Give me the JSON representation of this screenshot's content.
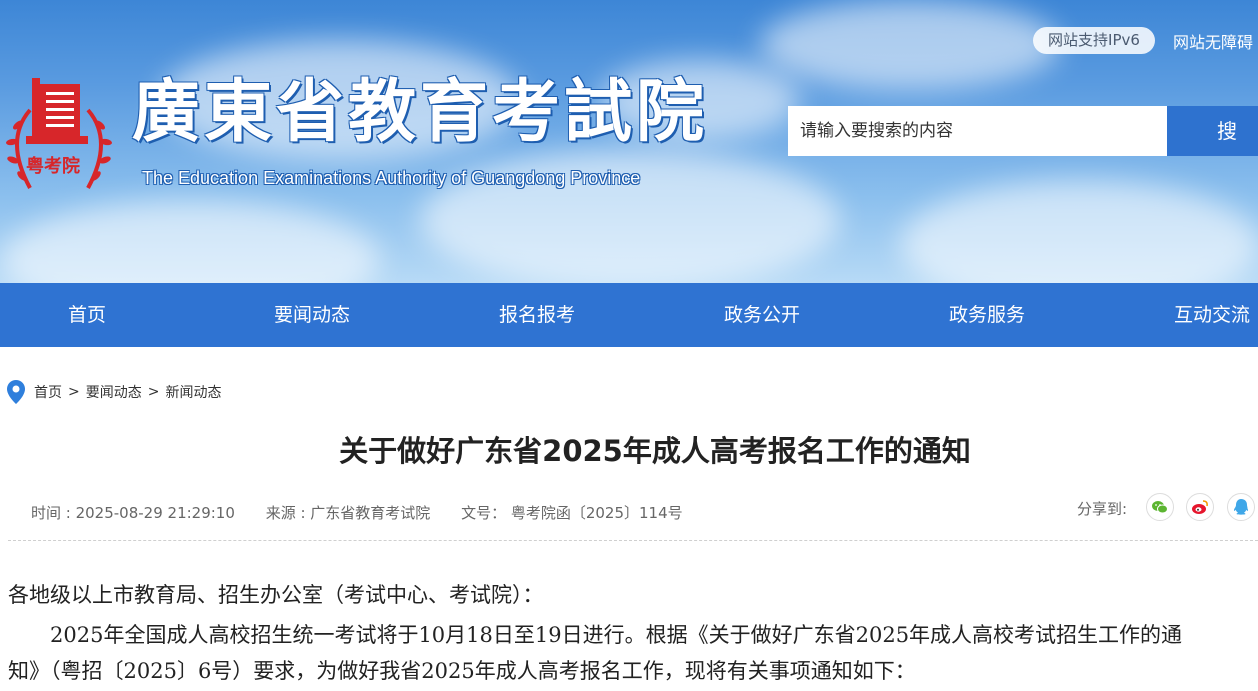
{
  "header": {
    "site_title": "廣東省教育考試院",
    "site_subtitle": "The Education Examinations Authority of Guangdong Province",
    "logo_text": "粤考院",
    "ipv6": "网站支持IPv6",
    "accessibility": "网站无障碍",
    "search_placeholder": "请输入要搜索的内容",
    "search_button": "搜"
  },
  "nav": {
    "items": [
      "首页",
      "要闻动态",
      "报名报考",
      "政务公开",
      "政务服务",
      "互动交流"
    ]
  },
  "breadcrumb": {
    "items": [
      "首页",
      "要闻动态",
      "新闻动态"
    ],
    "separator": ">"
  },
  "article": {
    "title": "关于做好广东省2025年成人高考报名工作的通知",
    "time": "时间 : 2025-08-29 21:29:10",
    "source": "来源 : 广东省教育考试院",
    "doc_no": "文号：  粤考院函〔2025〕114号",
    "share_label": "分享到:",
    "share_targets": [
      "wechat-icon",
      "weibo-icon",
      "qq-icon"
    ],
    "body": [
      "各地级以上市教育局、招生办公室（考试中心、考试院）：",
      "　　2025年全国成人高校招生统一考试将于10月18日至19日进行。根据《关于做好广东省2025年成人高校考试招生工作的通",
      "知》（粤招〔2025〕6号）要求，为做好我省2025年成人高考报名工作，现将有关事项通知如下："
    ]
  },
  "colors": {
    "nav_bg": "#2f73d2",
    "search_button_bg": "#2e72cf",
    "logo_red": "#d7262a"
  }
}
